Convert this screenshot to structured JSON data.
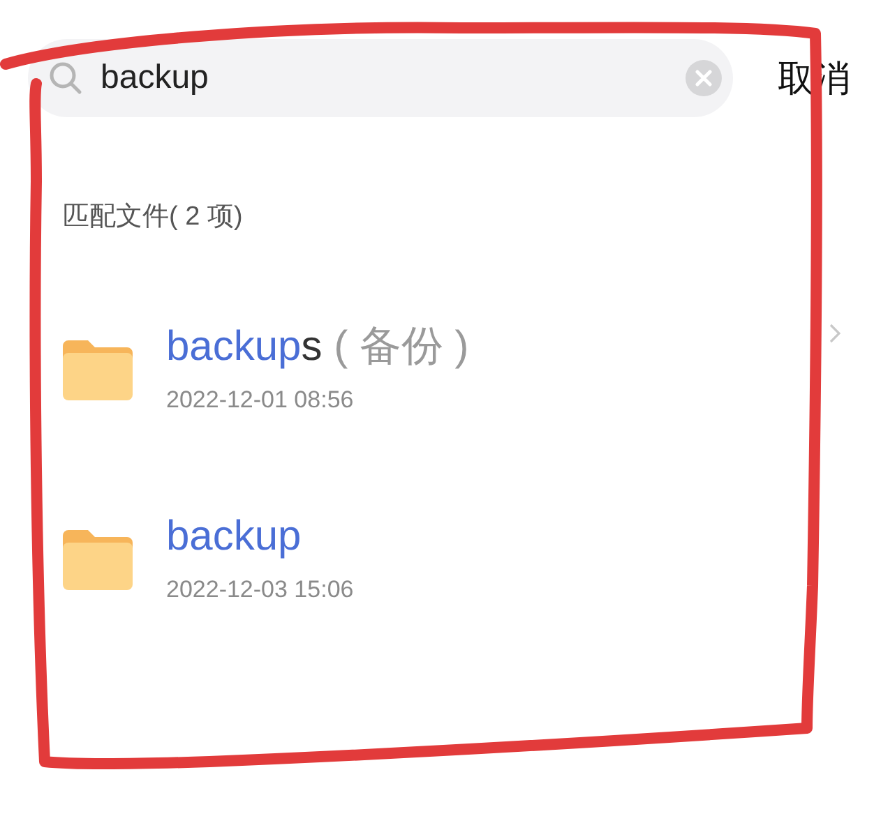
{
  "search": {
    "value": "backup",
    "cancel": "取消"
  },
  "section": {
    "title": "匹配文件( 2 项)"
  },
  "results": [
    {
      "segments": [
        {
          "kind": "match",
          "text": "backup"
        },
        {
          "kind": "plain",
          "text": "s"
        },
        {
          "kind": "note",
          "text": " ( 备份 )"
        }
      ],
      "date": "2022-12-01 08:56"
    },
    {
      "segments": [
        {
          "kind": "match",
          "text": "backup"
        }
      ],
      "date": "2022-12-03 15:06"
    }
  ]
}
